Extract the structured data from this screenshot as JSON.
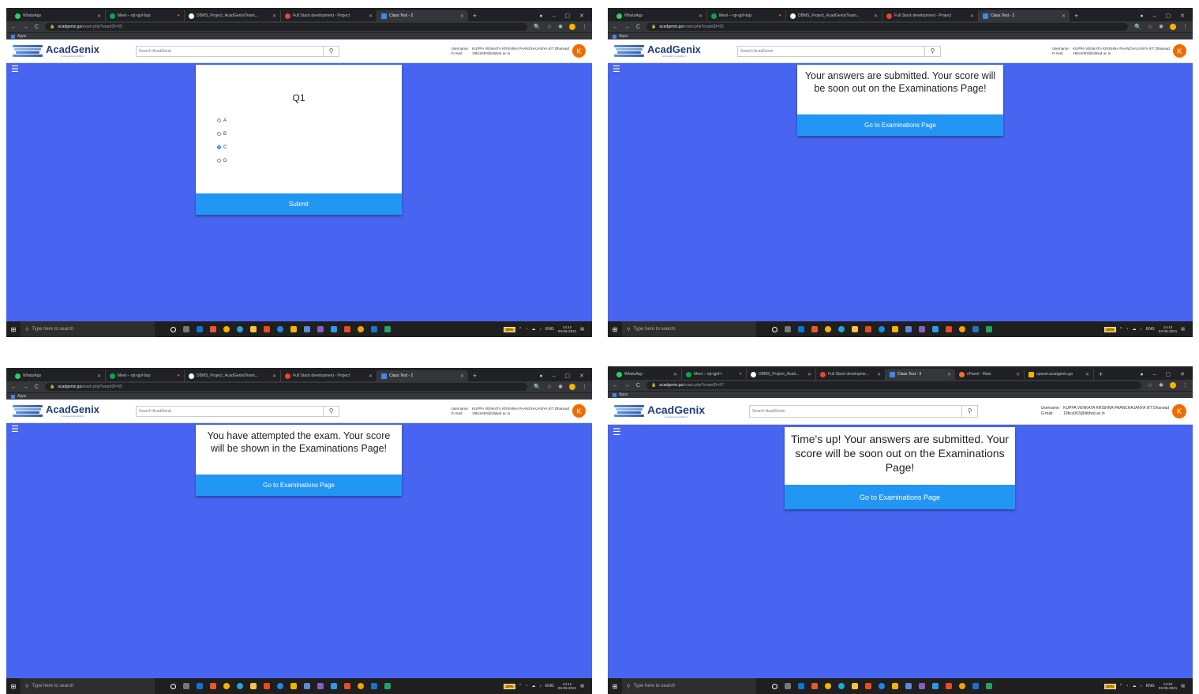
{
  "colors": {
    "page_bg": "#4865f2",
    "button": "#2196f3",
    "avatar": "#ef6c00",
    "browser_dark": "#202124",
    "logo_text": "#1f3d7a"
  },
  "common": {
    "logo_name": "AcadGenix",
    "logo_tagline": "an E-learning platform",
    "search_placeholder": "Search AcadGenix",
    "username_label": "Username:",
    "username_value": "KUPPA VENKATA KRISHNA PAANCHAJANYA IIIT Dharwad",
    "gmail_label": "G-mail:",
    "gmail_value": "19bcs063@iiitdwd.ac.in",
    "avatar_letter": "K",
    "bookmarks_apps": "Apps",
    "taskbar_search": "Type here to search",
    "battery": "20%",
    "lang": "ENG"
  },
  "q1": {
    "tabs": [
      {
        "label": "WhatsApp"
      },
      {
        "label": "Meet – rqt-qjsf-bqs"
      },
      {
        "label": "DBMS_Project_AcadGenix/Team..."
      },
      {
        "label": "Full Stack development - Project"
      },
      {
        "label": "Class Test - 2"
      }
    ],
    "url_domain": "acadgenix.ga",
    "url_path": "/exam.php?examID=55",
    "question_title": "Q1",
    "options": [
      {
        "label": "A",
        "selected": false
      },
      {
        "label": "B",
        "selected": false
      },
      {
        "label": "C",
        "selected": true
      },
      {
        "label": "D",
        "selected": false
      }
    ],
    "submit_label": "Submit",
    "time": "14:12",
    "date": "03-05-2021"
  },
  "submitted": {
    "tabs": [
      {
        "label": "WhatsApp"
      },
      {
        "label": "Meet – rqt-qjsf-bqs"
      },
      {
        "label": "DBMS_Project_AcadGenix/Team..."
      },
      {
        "label": "Full Stack development - Project"
      },
      {
        "label": "Class Test - 2"
      }
    ],
    "url_domain": "acadgenix.ga",
    "url_path": "/exam.php?examID=55",
    "message": "Your answers are submitted. Your score will be soon out on the Examinations Page!",
    "button_label": "Go to Examinations Page",
    "time": "14:12",
    "date": "03-05-2021"
  },
  "attempted": {
    "tabs": [
      {
        "label": "WhatsApp"
      },
      {
        "label": "Meet – rqt-qjsf-bqs"
      },
      {
        "label": "DBMS_Project_AcadGenix/Team..."
      },
      {
        "label": "Full Stack development - Project"
      },
      {
        "label": "Class Test - 2"
      }
    ],
    "url_domain": "acadgenix.ga",
    "url_path": "/exam.php?examID=55",
    "message": "You have attempted the exam. Your score will be shown in the Examinations Page!",
    "button_label": "Go to Examinations Page",
    "time": "14:12",
    "date": "03-05-2021"
  },
  "timeup": {
    "tabs": [
      {
        "label": "WhatsApp"
      },
      {
        "label": "Meet – rqt-qjsf-t"
      },
      {
        "label": "DBMS_Project_Acad..."
      },
      {
        "label": "Full Stack developme..."
      },
      {
        "label": "Class Test - 3"
      },
      {
        "label": "cPanel - Main"
      },
      {
        "label": "cpanel.acadgenix.ga"
      }
    ],
    "url_domain": "acadgenix.ga",
    "url_path": "/exam.php?examID=57",
    "message": "Time's up! Your answers are submitted. Your score will be soon out on the Examinations Page!",
    "button_label": "Go to Examinations Page",
    "time": "14:23",
    "date": "03-05-2021"
  }
}
